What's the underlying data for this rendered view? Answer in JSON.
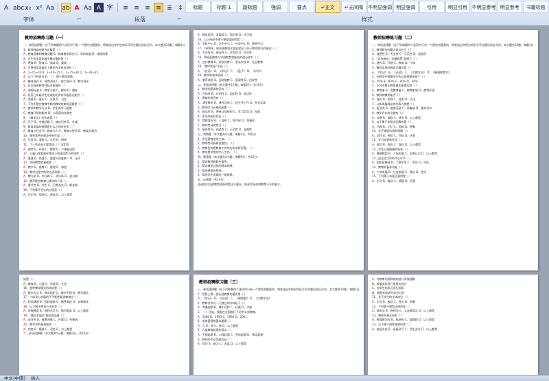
{
  "ribbon": {
    "format_buttons": [
      "A",
      "abc",
      "x₂",
      "x²",
      "Aa",
      "ab",
      "A",
      "Aa",
      "A",
      "字",
      "≡",
      "≡",
      "≡",
      "≡",
      "≣",
      "↕",
      "▦",
      "⊞"
    ],
    "groups": {
      "font": "字体",
      "paragraph": "段落"
    },
    "launcher": "⌐",
    "styles": [
      "标题",
      "标题 1",
      "副标题",
      "强调",
      "要点",
      "↵正文",
      "↵无间隔",
      "不明显强调",
      "明显强调",
      "引用",
      "明显引用",
      "不明显参考",
      "明显参考",
      "书籍标题"
    ],
    "active_style": "↵正文",
    "styles_label": "样式"
  },
  "pages": [
    {
      "title": "教师招聘练习题（一）",
      "lines": [
        "一、单项选择题（在下列每题四个选项中只有一个是符合题意的，将其选出并把它的标号写在题后的括号内，本大题共20题，每题1分，共20分）",
        "1、教师教育的研究对象是（ ）",
        "A、教育现象和教育问题  B、教育教学研究  C、学科发展  D、课程改革",
        "2、学生的全面发展中最关键的是（ ）",
        "A、德育  B、智育  C、体育  D、美育",
        "3、世界教育发展史上最早的学校出现在（ ）",
        "A、1~15~20  B、1~20~25  C、1~25~30  D、1~30~35",
        "4、以下几种说法中，（ ）属于教育测量。",
        "A、整体测评  B、体育测评  C、智力测评  D、教学测评",
        "5、在以国家教育目标为依据的（ ）",
        "A、课程标准  B、教学大纲  C、教材  D、教参",
        "6、培养三年级学生形成的初步的书面表达能力（ ）",
        "A、思维  B、意志  C、注意  D、记忆",
        "7、下列不是在教育中影响教学效果的因素是（ ）",
        "A、教师的教学方法  B、学生的学习态度",
        "C、教育环境的影响  D、与家庭的关联性",
        "8、《教学论》的作者是（ ）",
        "A、孔子  B、夸美纽斯  C、赫尔巴特  D、杜威",
        "9、教育发展的规律是什么之间的关系（ ）",
        "A、教育与社会  B、教育与人  C、教育与经济  D、教育与政治",
        "10、教师角色在教育中的作用（ ）",
        "A、引导  B、激励  C、示范  D、榜样",
        "11、个人的成长主要是由（ ）决定的",
        "A、遗传  B、环境  C、教育  D、个体能动性",
        "12、儿童心理发展在性质上的连续性与阶段性（ ）",
        "A、量变  B、质变  C、量变与质变统一  D、无序",
        "13、学校教育的基础是（ ）",
        "A、教学  B、德育  C、管理  D、课程",
        "14、教学过程中的双边活动指（ ）",
        "A、教与学  B、学与练  C、讲与听  D、说与做",
        "15、最早提出教育心理学的人是（ ）",
        "A、桑代克  B、华生  C、巴甫洛夫  D、斯金纳",
        "16、下列属于记忆的过程是（ ）",
        "A、识记  B、保持  C、再现  D、以上都是"
      ]
    },
    {
      "title": "",
      "lines": [
        "A、教育观  B、发展观  C、知识观  D、学习观",
        "16、以上所述不属于课程组织的是（ ）",
        "A、学科中心  B、学生中心  C、社会中心  D、教师中心",
        "17、1966年，联合国教科文组织提出《关于教师地位的建议》（ ）",
        "A、专业性  B、职业性  C、学术性  D、科学性",
        "18、将家庭教育与学校教育相结合的理论称为（ ）",
        "A、合作教育  B、家校共育  C、家长学校  D、社区教育",
        "19、\"教学相长\"出自（ ）",
        "A、《论语》  B、《学记》  C、《孟子》  D、《大学》",
        "20、教学的根本原则（ ）",
        "A、循序渐进  B、因材施教  C、直观性  D、启发性",
        "二、多项选择题（本大题共5小题，每题2分，共10分）",
        "1、教学的基本特征有（ ）",
        "A、目的性  B、计划性  C、组织性  D、双边性",
        "2、德育的途径有（ ）",
        "A、课堂教学  B、课外活动  C、班主任工作  D、社会实践",
        "3、影响学习迁移的因素（ ）",
        "A、相似性  B、原有认知结构  C、学习定势  D、年龄",
        "4、学生的权利包括（ ）",
        "A、受教育权  B、人身权  C、财产权  D、荣誉权",
        "5、教师劳动的特点（ ）",
        "A、复杂性  B、创造性  C、示范性  D、长期性",
        "三、判断题（本大题共4小题，每题2分，共8分）",
        "1、学生是教学的主体。（ ）",
        "2、教师劳动具有创造性。（ ）",
        "3、教育目的是教育工作的出发点和归宿。（ ）",
        "4、教学是学校的中心工作。（ ）",
        "四、简答题（本大题共4小题，每题6分，共24分）",
        "1、简述教师的职业角色。",
        "2、简述教学过程的基本规律。",
        "3、简述德育的原则。",
        "4、简述学生发展的一般规律。",
        "五、论述题（共14分）",
        "谈谈你对当前教育改革的看法与建议，联系实际说明教育公平的意义。"
      ]
    },
    {
      "title": "教师招聘练习题（二）",
      "lines": [
        "一、单项选择题（在下列每题四个选项中只有一个是符合题意的，将其选出并把它的标号写在题后的括号内，本大题共20题，每题1分，共20分）",
        "1、教师职业的最大特点在于（ ）",
        "A、道德性  B、专业性  C、示范性  D、创造性",
        "2、\"近朱者赤，近墨者黑\"说明了（ ）",
        "A、遗传  B、环境  C、教育  D、个体",
        "3、最早出现的教育学著作是（ ）",
        "A、《学记》  B、《论语》  C、《大教学论》  D、《普通教育学》",
        "4、在教学中遵循学生的认知规律体现了（ ）",
        "A、70%  B、80%  C、90%  D、60%",
        "5、下列不属于教育基本要素的是（ ）",
        "A、教育者  B、受教育者  C、教育影响  D、教育环境",
        "6、教师的教学能力（ ）",
        "A、理论  B、实践  C、经验  D、方法",
        "7、认知发展理论的代表人物是（ ）",
        "A、皮亚杰  B、维果茨基  C、布鲁纳  D、奥苏贝尔",
        "8、教学评价的功能有（ ）",
        "A、诊断  B、激励  C、调节  D、以上都是",
        "9、以下属于非智力因素的是（ ）",
        "A、兴趣  B、记忆  C、思维  D、想象",
        "10、关于课程内涵的理解（ ）",
        "A、学科  B、经验  C、目标  D、计划",
        "11、学习动机的作用（ ）",
        "A、激活  B、指向  C、强化  D、以上都是",
        "12、学生心理健康的标准（ ）",
        "A、情绪稳定  B、人际和谐  C、自我认识  D、以上都是",
        "13、班主任工作的中心环节（ ）",
        "A、组织班集体  B、了解学生  C、家访  D、评价",
        "14、教育的基本功能（ ）",
        "A、个体发展  B、社会发展  C、政治  D、经济",
        "15、下列属于有意注意的是（ ）",
        "A、主动  B、被动  C、随意  D、无意"
      ]
    },
    {
      "title": "",
      "lines": [
        "始是（ ）",
        "A、教育  B、心理  C、学校  D、社会",
        "16、各种教学模式的实质是（ ）",
        "A、教学方法  B、教学组织  C、教学手段  D、教学理念",
        "17、个体身心发展的不平衡性要求教育应（ ）",
        "A、抓关键期  B、因材施教  C、循序渐进  D、长善救失",
        "18、以下属于德育方法的是（ ）",
        "A、说服教育  B、榜样示范  C、陶冶教育  D、以上都是",
        "19、\"最近发展区\"理论提出者（ ）",
        "A、皮亚杰  B、维果茨基  C、杜威  D、布鲁纳",
        "20、教学中的直观原则（ ）",
        "A、实物  B、模像  C、语言  D、以上都是",
        "二、多项选择题（本大题共5小题，每题2分，共10分）"
      ]
    },
    {
      "title": "教师招聘练习题（三）",
      "lines": [
        "一、单项选择题（在下列每题四个选项中只有一个是符合题意的，将其选出并把它的标号写在题后的括号内，本大题共20题，每题1分，共20分）",
        "1、世界上第一部论述教育的著作是（ ）",
        "A、《学记》  B、《论语》  C、《理想国》  D、《大教学论》",
        "2、教育学作为一门独立的学科始于（ ）",
        "A、夸美纽斯  B、赫尔巴特  C、杜威  D、卢梭",
        "3、（ ）开始，我国在全国推行了初中义务教育。",
        "A、1986  B、1993  C、1995  D、2001",
        "4、学校管理的基本要素（ ）",
        "A、人  B、财  C、物  D、以上都是",
        "5、人类教育起源的观点（ ）",
        "A、生物起源  B、心理起源  C、劳动起源  D、神话起源",
        "6、教师的专业发展包括（ ）",
        "A、知识  B、能力  C、态度  D、以上都是"
      ]
    },
    {
      "title": "",
      "lines": [
        "A、对教育内容和结构进行有效理解",
        "B、根据实际进行系统化设计",
        "C、对学生的学习进行指导",
        "D、根据考核进行综合分析",
        "11、关于学生的主体地位（ ）",
        "A、主动  B、被动  C、独立  D、依赖",
        "12、下列属于教育法律的是（ ）",
        "A、教育法  B、教师法  C、义务教育法  D、以上都是",
        "13、教师的基本权利（ ）",
        "A、教育教学权  B、科研权  C、管理权  D、以上都是",
        "14、以下属于隐性课程的是（ ）",
        "A、校园文化  B、班级风气  C、师生关系  D、以上都是"
      ]
    }
  ],
  "status": {
    "language": "中文(中国)",
    "mode": "插入"
  }
}
